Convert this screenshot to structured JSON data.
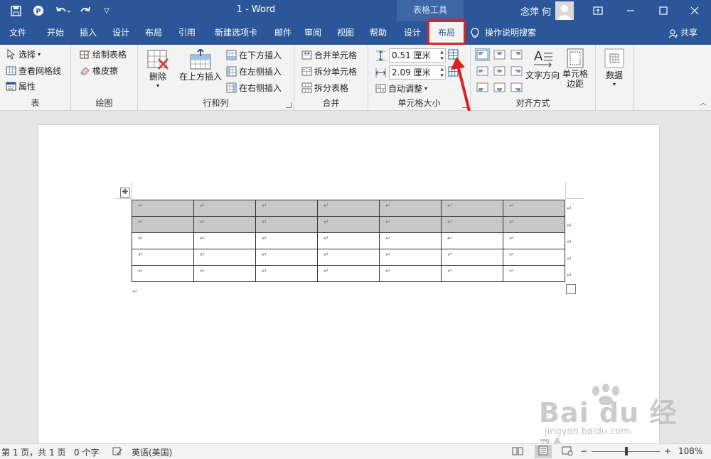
{
  "titlebar": {
    "doc_title": "1  -  Word",
    "context_tools": "表格工具",
    "user": "念萍 何"
  },
  "tabs": [
    {
      "label": "文件"
    },
    {
      "label": "开始"
    },
    {
      "label": "插入"
    },
    {
      "label": "设计"
    },
    {
      "label": "布局"
    },
    {
      "label": "引用"
    },
    {
      "label": "新建选项卡"
    },
    {
      "label": "邮件"
    },
    {
      "label": "审阅"
    },
    {
      "label": "视图"
    },
    {
      "label": "帮助"
    },
    {
      "label": "设计"
    },
    {
      "label": "布局"
    }
  ],
  "tellme": "操作说明搜索",
  "share": "共享",
  "ribbon": {
    "table_group": {
      "label": "表",
      "select": "选择",
      "view_gridlines": "查看网格线",
      "properties": "属性"
    },
    "draw_group": {
      "label": "绘图",
      "draw_table": "绘制表格",
      "eraser": "橡皮擦"
    },
    "rows_cols_group": {
      "label": "行和列",
      "delete": "删除",
      "insert_above": "在上方插入",
      "insert_below": "在下方插入",
      "insert_left": "在左侧插入",
      "insert_right": "在右侧插入"
    },
    "merge_group": {
      "label": "合并",
      "merge_cells": "合并单元格",
      "split_cells": "拆分单元格",
      "split_table": "拆分表格"
    },
    "cell_size_group": {
      "label": "单元格大小",
      "height": "0.51 厘米",
      "width": "2.09 厘米",
      "autofit": "自动调整"
    },
    "alignment_group": {
      "label": "对齐方式",
      "text_direction": "文字方向",
      "cell_margins_line1": "单元格",
      "cell_margins_line2": "边距"
    },
    "data_group": {
      "label": "数据"
    }
  },
  "document": {
    "cell_mark": "↵"
  },
  "watermark": {
    "main": "Bai du 经验",
    "sub": "jingyan.baidu.com"
  },
  "statusbar": {
    "page": "第 1 页，共 1 页",
    "words": "0 个字",
    "language": "英语(美国)",
    "zoom": "108%"
  },
  "colors": {
    "accent": "#2b579a",
    "highlight": "#e02020",
    "shaded_cell": "#c8c8c8"
  }
}
